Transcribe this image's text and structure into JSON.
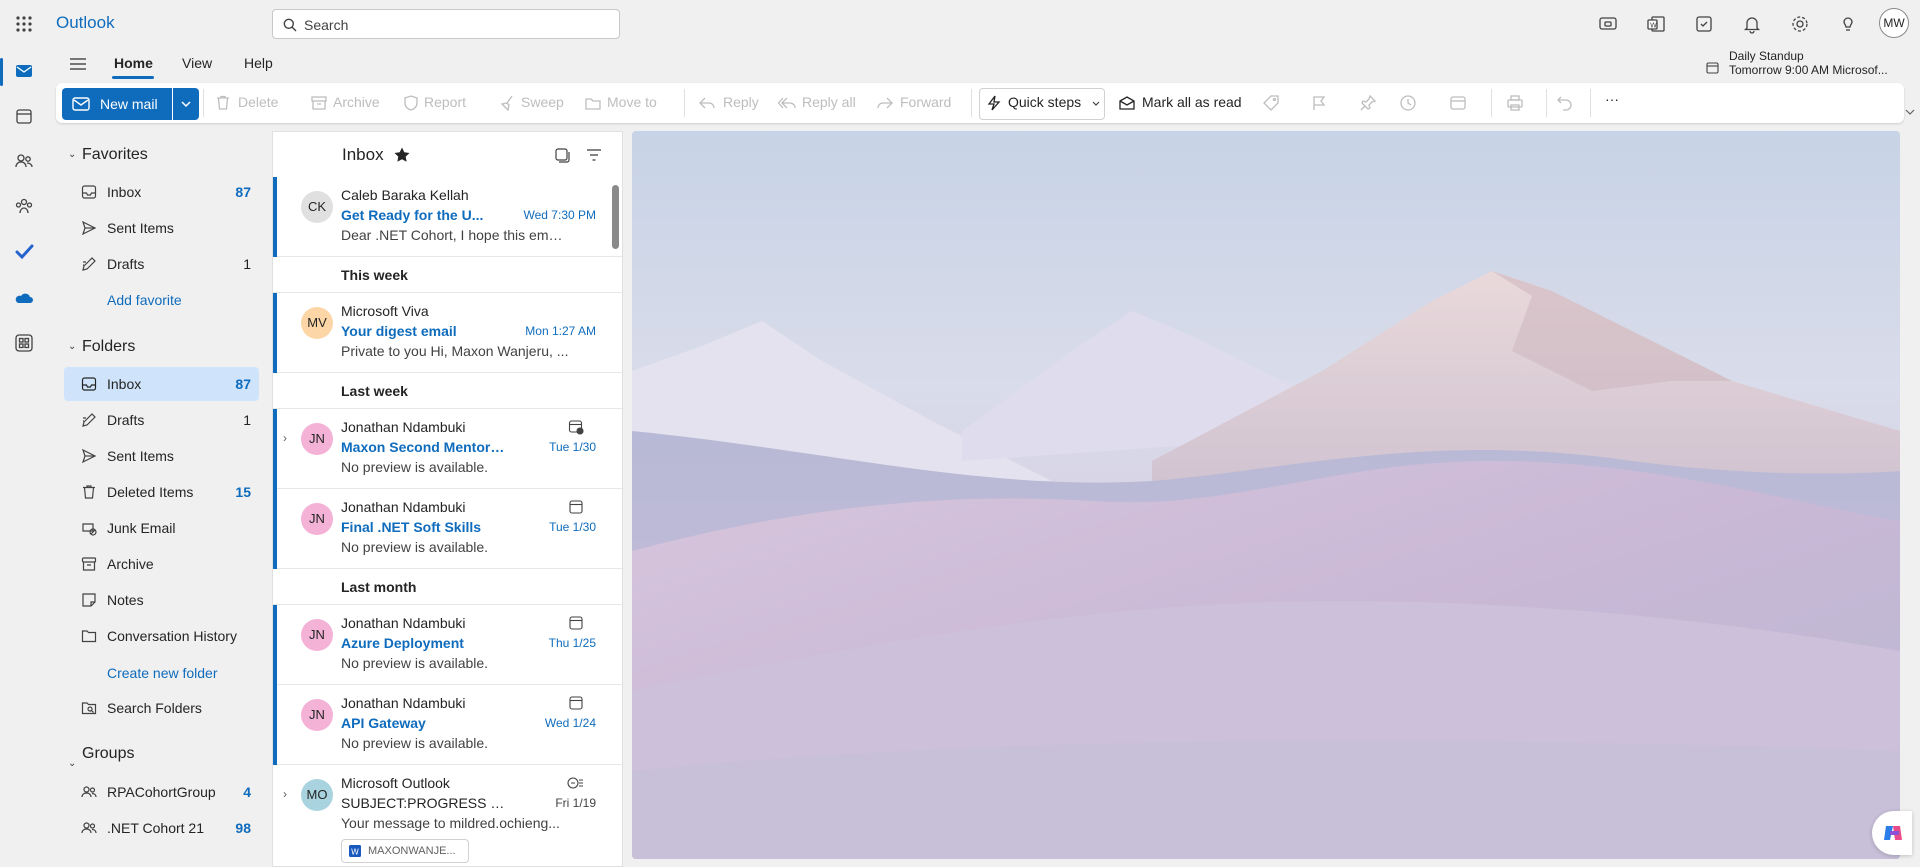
{
  "app": {
    "title": "Outlook"
  },
  "search": {
    "placeholder": "Search"
  },
  "user": {
    "initials": "MW"
  },
  "ribbon_tabs": [
    "Home",
    "View",
    "Help"
  ],
  "reminder": {
    "title": "Daily Standup",
    "detail": "Tomorrow 9:00 AM Microsof..."
  },
  "ribbon": {
    "new_mail": "New mail",
    "delete": "Delete",
    "archive": "Archive",
    "report": "Report",
    "sweep": "Sweep",
    "move_to": "Move to",
    "reply": "Reply",
    "reply_all": "Reply all",
    "forward": "Forward",
    "quick_steps": "Quick steps",
    "mark_all_read": "Mark all as read",
    "more": "···"
  },
  "favorites": {
    "header": "Favorites",
    "items": [
      {
        "label": "Inbox",
        "count": "87"
      },
      {
        "label": "Sent Items",
        "count": ""
      },
      {
        "label": "Drafts",
        "count": "1"
      }
    ],
    "add": "Add favorite"
  },
  "folders": {
    "header": "Folders",
    "items": [
      {
        "label": "Inbox",
        "count": "87"
      },
      {
        "label": "Drafts",
        "count": "1"
      },
      {
        "label": "Sent Items",
        "count": ""
      },
      {
        "label": "Deleted Items",
        "count": "15"
      },
      {
        "label": "Junk Email",
        "count": ""
      },
      {
        "label": "Archive",
        "count": ""
      },
      {
        "label": "Notes",
        "count": ""
      },
      {
        "label": "Conversation History",
        "count": ""
      }
    ],
    "create": "Create new folder",
    "search_folders": "Search Folders"
  },
  "groups": {
    "header": "Groups",
    "items": [
      {
        "label": "RPACohortGroup",
        "count": "4"
      },
      {
        "label": ".NET Cohort 21",
        "count": "98"
      }
    ]
  },
  "message_list": {
    "title": "Inbox",
    "group_labels": [
      "This week",
      "Last week",
      "Last month"
    ],
    "messages": [
      {
        "initials": "CK",
        "avatar_color": "#e0e0e0",
        "from": "Caleb Baraka Kellah",
        "subject": "Get Ready for the U...",
        "date": "Wed 7:30 PM",
        "preview": "Dear .NET Cohort, I hope this email..."
      },
      {
        "initials": "MV",
        "avatar_color": "#fcd6a7",
        "from": "Microsoft Viva",
        "subject": "Your digest email",
        "date": "Mon 1:27 AM",
        "preview": "Private to you Hi, Maxon Wanjeru, ..."
      },
      {
        "initials": "JN",
        "avatar_color": "#f3b2d6",
        "from": "Jonathan Ndambuki",
        "subject": "Maxon Second Mentors...",
        "date": "Tue 1/30",
        "preview": "No preview is available."
      },
      {
        "initials": "JN",
        "avatar_color": "#f3b2d6",
        "from": "Jonathan Ndambuki",
        "subject": "Final .NET Soft Skills",
        "date": "Tue 1/30",
        "preview": "No preview is available."
      },
      {
        "initials": "JN",
        "avatar_color": "#f3b2d6",
        "from": "Jonathan Ndambuki",
        "subject": "Azure Deployment",
        "date": "Thu 1/25",
        "preview": "No preview is available."
      },
      {
        "initials": "JN",
        "avatar_color": "#f3b2d6",
        "from": "Jonathan Ndambuki",
        "subject": "API Gateway",
        "date": "Wed 1/24",
        "preview": "No preview is available."
      },
      {
        "initials": "MO",
        "avatar_color": "#a9d3df",
        "from": "Microsoft Outlook",
        "subject": "SUBJECT:PROGRESS ON ...",
        "date": "Fri 1/19",
        "preview": "Your message to mildred.ochieng...",
        "attachment": "MAXONWANJE..."
      }
    ]
  },
  "colors": {
    "accent": "#0f6cbd",
    "selected_folder": "#cfe4fa"
  }
}
